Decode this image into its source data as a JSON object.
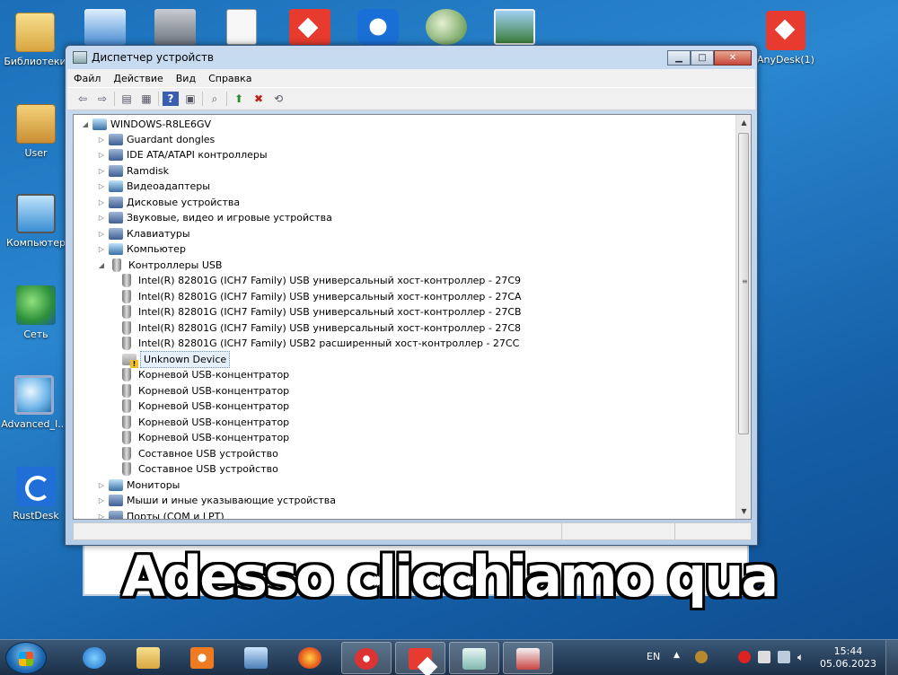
{
  "desktop": {
    "icons": [
      {
        "label": "Библиотеки"
      },
      {
        "label": "User"
      },
      {
        "label": "Компьютер"
      },
      {
        "label": "Сеть"
      },
      {
        "label": "Advanced_I..."
      },
      {
        "label": "RustDesk"
      },
      {
        "label": "AnyDesk(1)"
      }
    ]
  },
  "window": {
    "title": "Диспетчер устройств",
    "buttons": {
      "minimize": "▁",
      "maximize": "□",
      "close": "✕"
    },
    "menu": [
      "Файл",
      "Действие",
      "Вид",
      "Справка"
    ],
    "toolbar_icons": [
      "back-arrow-icon",
      "forward-arrow-icon",
      "console-tree-icon",
      "properties-icon",
      "help-icon",
      "view-icon",
      "scan-hardware-icon",
      "update-driver-icon",
      "disable-device-icon",
      "uninstall-device-icon"
    ],
    "tree": {
      "root": "WINDOWS-R8LE6GV",
      "categories_before": [
        "Guardant dongles",
        "IDE ATA/ATAPI контроллеры",
        "Ramdisk",
        "Видеоадаптеры",
        "Дисковые устройства",
        "Звуковые, видео и игровые устройства",
        "Клавиатуры",
        "Компьютер"
      ],
      "usb_category": "Контроллеры USB",
      "usb_children": [
        "Intel(R) 82801G (ICH7 Family) USB универсальный хост-контроллер  - 27C9",
        "Intel(R) 82801G (ICH7 Family) USB универсальный хост-контроллер  - 27CA",
        "Intel(R) 82801G (ICH7 Family) USB универсальный хост-контроллер  - 27CB",
        "Intel(R) 82801G (ICH7 Family) USB универсальный хост-контроллер  - 27C8",
        "Intel(R) 82801G (ICH7 Family) USB2 расширенный хост-контроллер  - 27CC",
        "Unknown Device",
        "Корневой USB-концентратор",
        "Корневой USB-концентратор",
        "Корневой USB-концентратор",
        "Корневой USB-концентратор",
        "Корневой USB-концентратор",
        "Составное USB устройство",
        "Составное USB устройство"
      ],
      "categories_after": [
        "Мониторы",
        "Мыши и иные указывающие устройства",
        "Порты (COM и LPT)"
      ],
      "selected": "Unknown Device"
    }
  },
  "caption": "Adesso clicchiamo qua",
  "taskbar": {
    "language": "EN",
    "time": "15:44",
    "date": "05.06.2023"
  },
  "colors": {
    "desktop_bg": "#1b6fb8",
    "anydesk_red": "#e63b2e",
    "selection_bg": "#e5f0fb"
  }
}
